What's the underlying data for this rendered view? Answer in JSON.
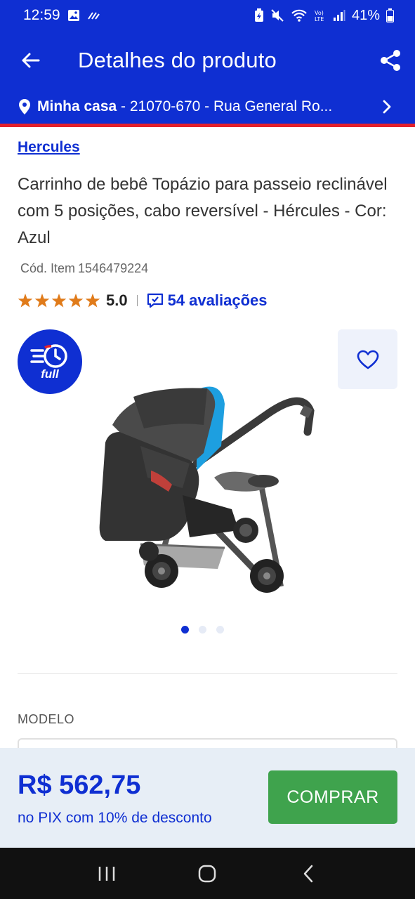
{
  "status_bar": {
    "time": "12:59",
    "battery": "41%"
  },
  "header": {
    "title": "Detalhes do produto"
  },
  "address": {
    "name": "Minha casa",
    "details": " - 21070-670 - Rua General Ro..."
  },
  "product": {
    "brand": "Hercules",
    "title": "Carrinho de bebê Topázio para passeio reclinável com 5 posições, cabo reversível - Hércules - Cor: Azul",
    "sku_label": "Cód. Item",
    "sku_value": "1546479224",
    "rating": "5.0",
    "stars": 5,
    "reviews": "54 avaliações",
    "badge": "full"
  },
  "gallery": {
    "image_count": 3,
    "active_index": 0
  },
  "options": {
    "model_label": "MODELO"
  },
  "purchase": {
    "price": "R$ 562,75",
    "price_note": "no PIX com 10% de desconto",
    "buy_label": "COMPRAR"
  },
  "colors": {
    "brand_blue": "#0f2fd2",
    "accent_red": "#e4202c",
    "buy_green": "#3fa34d",
    "star_orange": "#e07b1a"
  }
}
